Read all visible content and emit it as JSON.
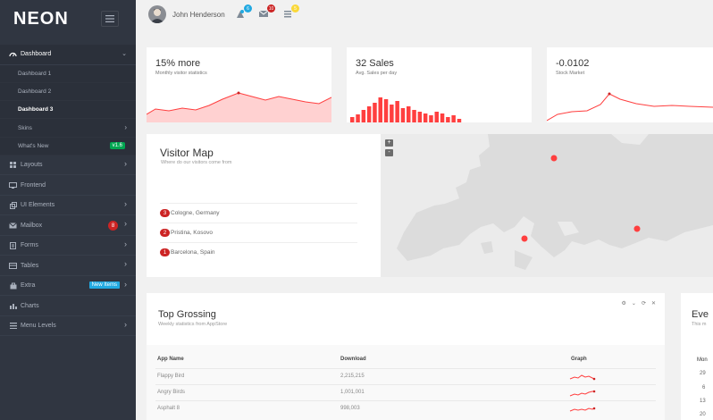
{
  "brand": {
    "logo": "NEON"
  },
  "sidebar": {
    "items": [
      {
        "label": "Dashboard",
        "icon": "gauge-icon"
      },
      {
        "label": "Layouts",
        "icon": "grid-icon"
      },
      {
        "label": "Frontend",
        "icon": "monitor-icon"
      },
      {
        "label": "UI Elements",
        "icon": "layers-icon"
      },
      {
        "label": "Mailbox",
        "icon": "mail-icon",
        "badge": "8"
      },
      {
        "label": "Forms",
        "icon": "doc-icon"
      },
      {
        "label": "Tables",
        "icon": "table-icon"
      },
      {
        "label": "Extra",
        "icon": "bag-icon",
        "badge": "New Items"
      },
      {
        "label": "Charts",
        "icon": "chart-icon"
      },
      {
        "label": "Menu Levels",
        "icon": "list-icon"
      }
    ],
    "submenu": [
      {
        "label": "Dashboard 1"
      },
      {
        "label": "Dashboard 2"
      },
      {
        "label": "Dashboard 3"
      },
      {
        "label": "Skins"
      },
      {
        "label": "What's New",
        "badge": "v1.6"
      }
    ]
  },
  "topbar": {
    "user_name": "John Henderson",
    "notif_count_1": "6",
    "notif_count_2": "10",
    "notif_count_3": "5"
  },
  "tiles": [
    {
      "value": "15% more",
      "label": "Monthly visitor statistics"
    },
    {
      "value": "32 Sales",
      "label": "Avg. Sales per day"
    },
    {
      "value": "-0.0102",
      "label": "Stock Market"
    }
  ],
  "visitor_map": {
    "title": "Visitor Map",
    "subtitle": "Where do our visitors come from",
    "cities": [
      {
        "rank": "3",
        "name": "Cologne, Germany"
      },
      {
        "rank": "2",
        "name": "Pristina, Kosovo"
      },
      {
        "rank": "1",
        "name": "Barcelona, Spain"
      }
    ],
    "zoom_in": "+",
    "zoom_out": "-"
  },
  "top_grossing": {
    "title": "Top Grossing",
    "subtitle": "Weekly statistics from AppStore",
    "columns": [
      "App Name",
      "Download",
      "Graph"
    ],
    "rows": [
      {
        "name": "Flappy Bird",
        "downloads": "2,215,215"
      },
      {
        "name": "Angry Birds",
        "downloads": "1,001,001"
      },
      {
        "name": "Asphalt 8",
        "downloads": "998,003"
      }
    ]
  },
  "events": {
    "title": "Eve",
    "subtitle": "This m",
    "weekday": "Mon",
    "days": [
      "29",
      "6",
      "13",
      "20"
    ]
  },
  "colors": {
    "sidebar": "#303641",
    "accent": "#ff3f3f",
    "green": "#00a651",
    "blue": "#21a9e1"
  }
}
